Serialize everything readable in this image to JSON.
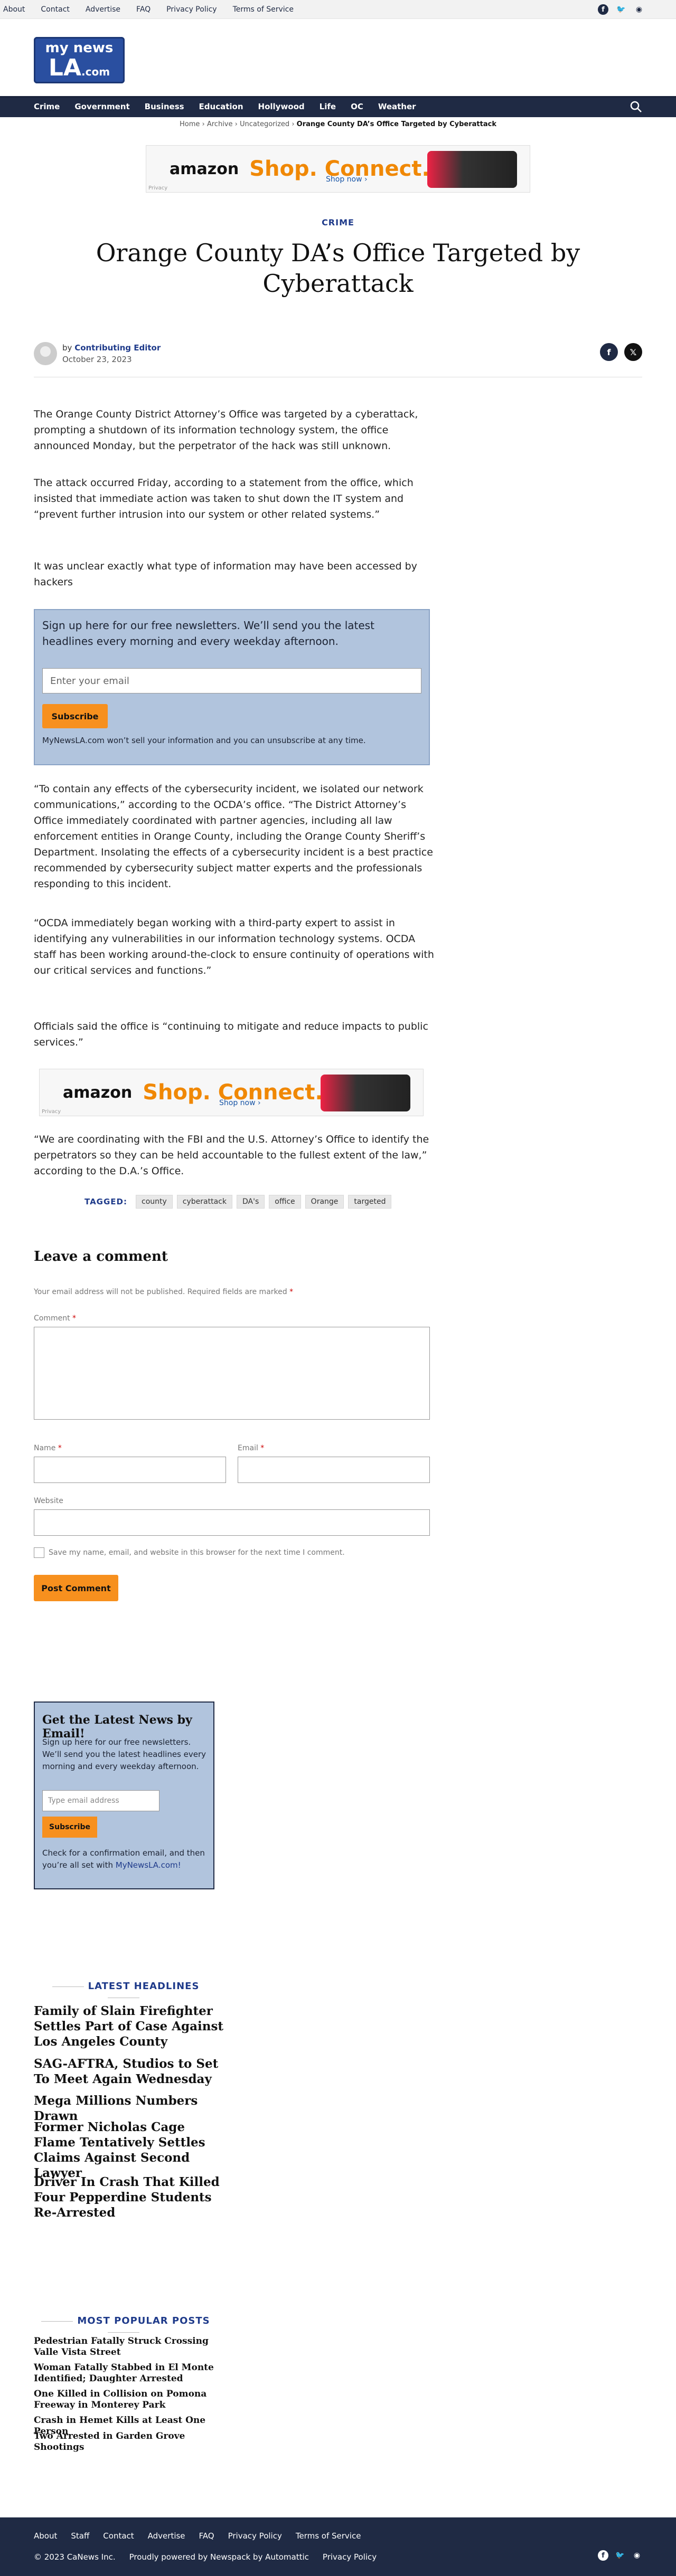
{
  "topbar": {
    "links": [
      "About",
      "Contact",
      "Advertise",
      "FAQ",
      "Privacy Policy",
      "Terms of Service"
    ]
  },
  "logo": {
    "line1": "my news",
    "line2": "LA",
    "line3": ".com"
  },
  "nav": {
    "items": [
      "Crime",
      "Government",
      "Business",
      "Education",
      "Hollywood",
      "Life",
      "OC",
      "Weather"
    ]
  },
  "breadcrumb": {
    "home": "Home",
    "archive": "Archive",
    "uncat": "Uncategorized",
    "current": "Orange County DA’s Office Targeted by Cyberattack"
  },
  "ad": {
    "brand": "amazon",
    "headline": "Shop. Connect. Enjoy.",
    "cta": "Shop now ›",
    "privacy": "Privacy"
  },
  "article": {
    "category": "CRIME",
    "title": "Orange County DA’s Office Targeted by Cyberattack",
    "by": "by",
    "author": "Contributing Editor",
    "date": "October 23, 2023",
    "p1": "The Orange County District Attorney’s Office was targeted by a cyberattack, prompting a shutdown of its information technology system, the office announced Monday, but the perpetrator of the hack was still unknown.",
    "p2": "The attack occurred Friday, according to a statement from the office, which insisted that immediate action was taken to shut down the IT system and “prevent further intrusion into our system or other related systems.”",
    "p3": "It was unclear exactly what type of information may have been accessed by hackers",
    "p4": "“To contain any effects of the cybersecurity incident, we isolated our network communications,” according to the OCDA’s office. “The District Attorney’s Office immediately coordinated with partner agencies, including all law enforcement entities in Orange County, including the Orange County Sheriff’s Department. Insolating the effects of a cybersecurity incident is a best practice recommended by cybersecurity subject matter experts and the professionals responding to this incident.",
    "p5": "“OCDA immediately began working with a third-party expert to assist in identifying any vulnerabilities in our information technology systems. OCDA staff has been working around-the-clock to ensure continuity of operations with our critical services and functions.”",
    "p6": "Officials said the office is “continuing to mitigate and reduce impacts to public services.”",
    "p7": "“We are coordinating with the FBI and the U.S. Attorney’s Office to identify the perpetrators so they can be held accountable to the fullest extent of the law,” according to the D.A.’s Office.",
    "tagged_label": "TAGGED:",
    "tags": [
      "county",
      "cyberattack",
      "DA's",
      "office",
      "Orange",
      "targeted"
    ]
  },
  "newsletter": {
    "heading": "Sign up here for our free newsletters. We’ll send you the latest headlines every morning and every weekday afternoon.",
    "placeholder": "Enter your email",
    "button": "Subscribe",
    "note": "MyNewsLA.com won’t sell your information and you can unsubscribe at any time."
  },
  "comments": {
    "heading": "Leave a comment",
    "notice": "Your email address will not be published.",
    "required_note": "Required fields are marked",
    "comment_label": "Comment",
    "name_label": "Name",
    "email_label": "Email",
    "website_label": "Website",
    "save_label": "Save my name, email, and website in this browser for the next time I comment.",
    "post_button": "Post Comment"
  },
  "sidebar_newsletter": {
    "heading": "Get the Latest News by Email!",
    "text": "Sign up here for our free newsletters. We’ll send you the latest headlines every morning and every weekday afternoon.",
    "placeholder": "Type email address",
    "button": "Subscribe",
    "note_a": "Check for a confirmation email, and then you’re all set with ",
    "note_link": "MyNewsLA.com!"
  },
  "latest": {
    "heading": "LATEST HEADLINES",
    "items": [
      "Family of Slain Firefighter Settles Part of Case Against Los Angeles County",
      "SAG-AFTRA, Studios to Set To Meet Again Wednesday",
      "Mega Millions Numbers Drawn",
      "Former Nicholas Cage Flame Tentatively Settles Claims Against Second Lawyer",
      "Driver In Crash That Killed Four Pepperdine Students Re-Arrested"
    ]
  },
  "popular": {
    "heading": "MOST POPULAR POSTS",
    "items": [
      "Pedestrian Fatally Struck Crossing Valle Vista Street",
      "Woman Fatally Stabbed in El Monte Identified; Daughter Arrested",
      "One Killed in Collision on Pomona Freeway in Monterey Park",
      "Crash in Hemet Kills at Least One Person",
      "Two Arrested in Garden Grove Shootings"
    ]
  },
  "footer": {
    "links": [
      "About",
      "Staff",
      "Contact",
      "Advertise",
      "FAQ",
      "Privacy Policy",
      "Terms of Service"
    ],
    "copyright": "© 2023 CaNews Inc.",
    "powered": "Proudly powered by Newspack by Automattic",
    "privacy": "Privacy Policy"
  },
  "colors": {
    "navy": "#1f2a44",
    "accent": "#f7901e",
    "link": "#1e3a8a",
    "box": "#b1c4dd"
  }
}
